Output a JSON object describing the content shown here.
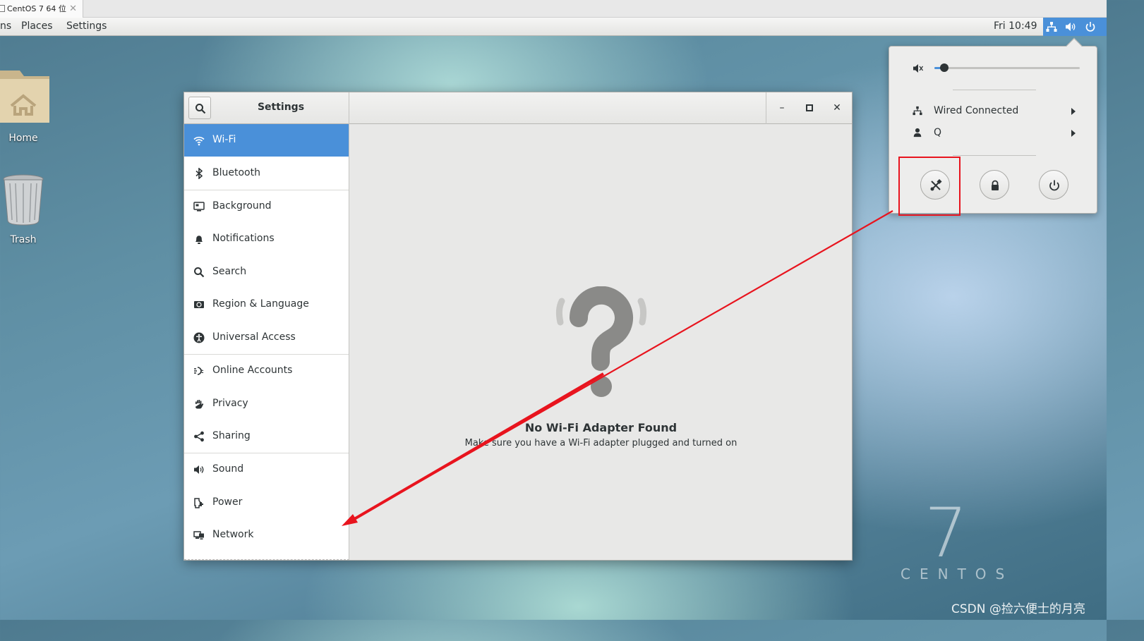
{
  "vm_tab": {
    "title": "CentOS 7 64 位",
    "close": "✕"
  },
  "topbar": {
    "apps_partial": "ns",
    "places": "Places",
    "settings": "Settings",
    "clock": "Fri 10:49"
  },
  "desktop": {
    "home_label": "Home",
    "trash_label": "Trash"
  },
  "settings_window": {
    "title": "Settings",
    "controls": {
      "minimize": "–",
      "maximize": "▫",
      "close": "✕"
    },
    "sidebar": [
      {
        "label": "Wi-Fi",
        "icon": "wifi-icon",
        "active": true
      },
      {
        "label": "Bluetooth",
        "icon": "bluetooth-icon"
      },
      {
        "label": "Background",
        "icon": "background-icon"
      },
      {
        "label": "Notifications",
        "icon": "bell-icon"
      },
      {
        "label": "Search",
        "icon": "search-icon"
      },
      {
        "label": "Region & Language",
        "icon": "region-icon"
      },
      {
        "label": "Universal Access",
        "icon": "accessibility-icon"
      },
      {
        "label": "Online Accounts",
        "icon": "online-accounts-icon"
      },
      {
        "label": "Privacy",
        "icon": "hand-icon"
      },
      {
        "label": "Sharing",
        "icon": "share-icon"
      },
      {
        "label": "Sound",
        "icon": "speaker-icon"
      },
      {
        "label": "Power",
        "icon": "power-plug-icon"
      },
      {
        "label": "Network",
        "icon": "network-icon"
      }
    ],
    "empty_state": {
      "icon": "question-mark-icon",
      "title": "No Wi-Fi Adapter Found",
      "subtitle": "Make sure you have a Wi-Fi adapter plugged and turned on"
    }
  },
  "system_menu": {
    "volume_level": 0.07,
    "wired": "Wired Connected",
    "user": "Q",
    "buttons": [
      "settings-icon",
      "lock-icon",
      "power-icon"
    ]
  },
  "branding": {
    "centos_number": "7",
    "centos_word": "CENTOS",
    "watermark": "CSDN @捡六便士的月亮"
  },
  "colors": {
    "accent": "#4a90d9",
    "annotation": "#e8141e"
  }
}
